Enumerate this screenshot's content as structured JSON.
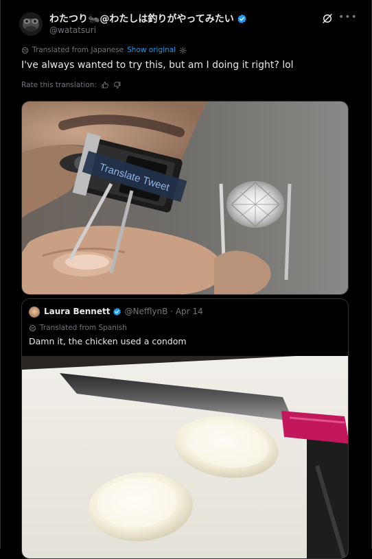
{
  "tweet": {
    "display_name": "わたつり🐜@わたしは釣りがやってみたい",
    "handle": "@watatsuri",
    "translation_label": "Translated from Japanese",
    "show_original_label": "Show original",
    "text": "I've always wanted to try this, but am I doing it right? lol",
    "rate_label": "Rate this translation:",
    "image": {
      "overlay_caption": "Translate Tweet"
    }
  },
  "quote": {
    "display_name": "Laura Bennett",
    "handle_and_time": "@NefflynB · Apr 14",
    "translation_label": "Translated from Spanish",
    "text": "Damn it, the chicken used a condom"
  },
  "icons": {
    "verified": "verified-badge-icon",
    "grok": "grok-icon",
    "more": "more-icon",
    "translate": "translate-globe-icon",
    "settings": "gear-icon",
    "thumbs_up": "thumbs-up-icon",
    "thumbs_down": "thumbs-down-icon"
  },
  "colors": {
    "background": "#000000",
    "text_primary": "#e7e9ea",
    "text_secondary": "#71767b",
    "accent": "#1d9bf0",
    "border": "#2f3336"
  }
}
